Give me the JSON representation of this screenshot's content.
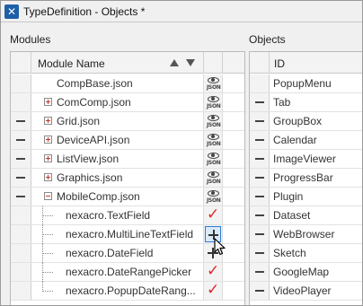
{
  "window": {
    "title": "TypeDefinition - Objects *",
    "app_icon": "app-x-icon"
  },
  "modules": {
    "panel_title": "Modules",
    "columns": {
      "module_name": "Module Name"
    },
    "rows": [
      {
        "name": "CompBase.json",
        "kind": "file",
        "selector": "",
        "action": "json"
      },
      {
        "name": "ComComp.json",
        "kind": "collapsed",
        "selector": "",
        "action": "json"
      },
      {
        "name": "Grid.json",
        "kind": "collapsed",
        "selector": "dash",
        "action": "json"
      },
      {
        "name": "DeviceAPI.json",
        "kind": "collapsed",
        "selector": "dash",
        "action": "json"
      },
      {
        "name": "ListView.json",
        "kind": "collapsed",
        "selector": "dash",
        "action": "json"
      },
      {
        "name": "Graphics.json",
        "kind": "collapsed",
        "selector": "dash",
        "action": "json"
      },
      {
        "name": "MobileComp.json",
        "kind": "expanded",
        "selector": "dash",
        "action": "json"
      },
      {
        "name": "nexacro.TextField",
        "kind": "child",
        "selector": "",
        "action": "check"
      },
      {
        "name": "nexacro.MultiLineTextField",
        "kind": "child",
        "selector": "",
        "action": "add-selected"
      },
      {
        "name": "nexacro.DateField",
        "kind": "child",
        "selector": "",
        "action": "add"
      },
      {
        "name": "nexacro.DateRangePicker",
        "kind": "child",
        "selector": "",
        "action": "check"
      },
      {
        "name": "nexacro.PopupDateRang...",
        "kind": "child-last",
        "selector": "",
        "action": "check"
      }
    ],
    "json_icon_text": "JSON"
  },
  "objects": {
    "panel_title": "Objects",
    "columns": {
      "id": "ID"
    },
    "rows": [
      {
        "id": "PopupMenu",
        "selector": ""
      },
      {
        "id": "Tab",
        "selector": "dash"
      },
      {
        "id": "GroupBox",
        "selector": "dash"
      },
      {
        "id": "Calendar",
        "selector": "dash"
      },
      {
        "id": "ImageViewer",
        "selector": "dash"
      },
      {
        "id": "ProgressBar",
        "selector": "dash"
      },
      {
        "id": "Plugin",
        "selector": "dash"
      },
      {
        "id": "Dataset",
        "selector": "dash"
      },
      {
        "id": "WebBrowser",
        "selector": "dash"
      },
      {
        "id": "Sketch",
        "selector": "dash"
      },
      {
        "id": "GoogleMap",
        "selector": "dash"
      },
      {
        "id": "VideoPlayer",
        "selector": "dash"
      }
    ]
  },
  "colors": {
    "check": "#e0282a",
    "selection": "#2b7bd6",
    "expander": "#c0392b"
  }
}
